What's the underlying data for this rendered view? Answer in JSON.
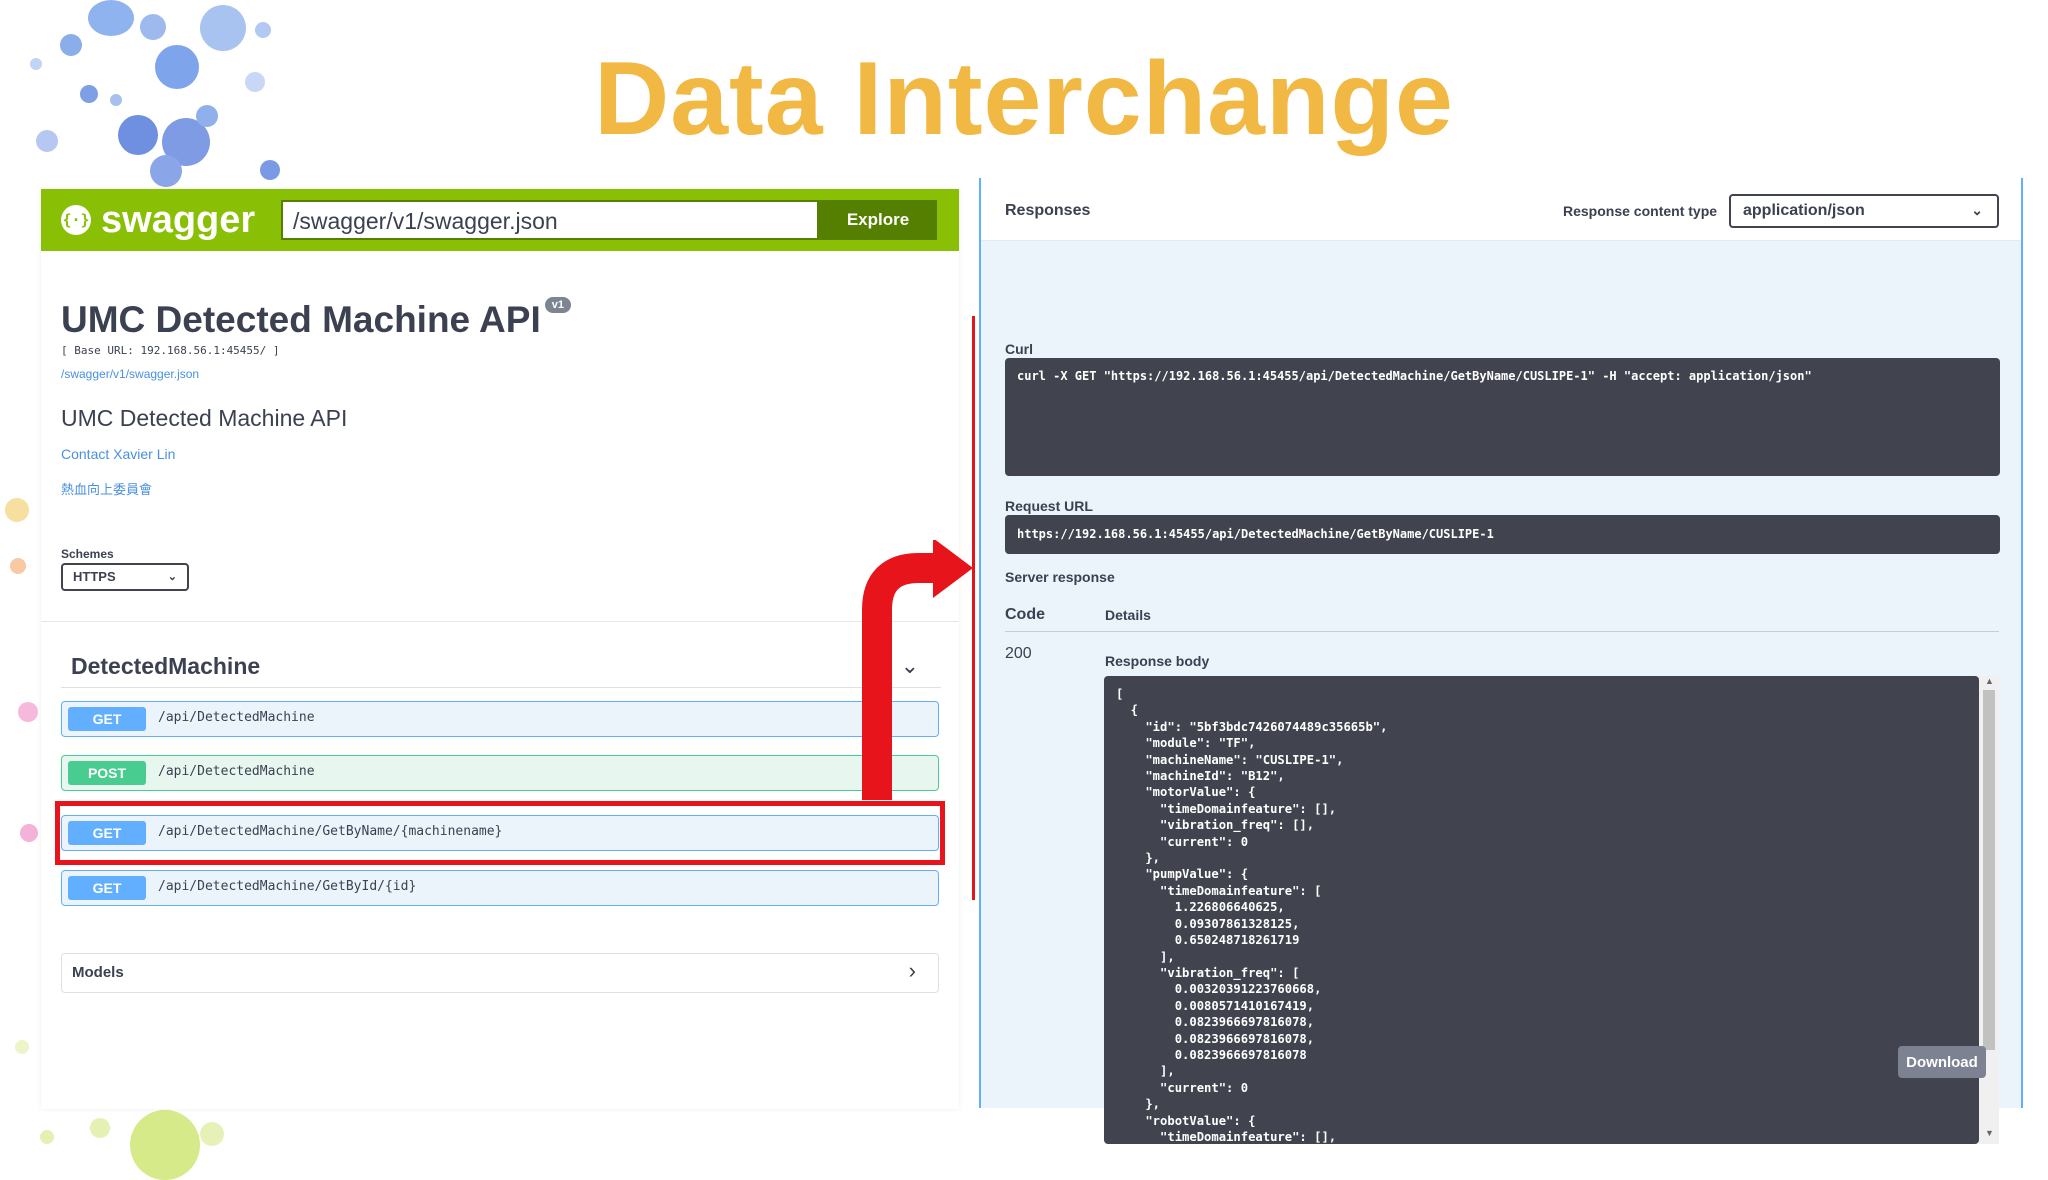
{
  "slide": {
    "title": "Data Interchange"
  },
  "swagger": {
    "logo_text": "swagger",
    "logo_icon": "swagger-braces-icon",
    "spec_url_value": "/swagger/v1/swagger.json",
    "explore_label": "Explore",
    "info": {
      "title": "UMC Detected Machine API",
      "version": "v1",
      "base_url": "[ Base URL: 192.168.56.1:45455/ ]",
      "spec_link": "/swagger/v1/swagger.json",
      "description": "UMC Detected Machine API",
      "contact": "Contact Xavier Lin",
      "license": "熱血向上委員會"
    },
    "schemes": {
      "label": "Schemes",
      "selected": "HTTPS"
    },
    "tag": {
      "name": "DetectedMachine"
    },
    "operations": [
      {
        "method": "GET",
        "path": "/api/DetectedMachine"
      },
      {
        "method": "POST",
        "path": "/api/DetectedMachine"
      },
      {
        "method": "GET",
        "path": "/api/DetectedMachine/GetByName/{machinename}"
      },
      {
        "method": "GET",
        "path": "/api/DetectedMachine/GetById/{id}"
      }
    ],
    "models_label": "Models",
    "colors": {
      "topbar": "#89bf04",
      "get": "#61affe",
      "post": "#49cc90",
      "highlight": "#e8141b"
    }
  },
  "responses": {
    "title": "Responses",
    "content_type_label": "Response content type",
    "content_type_value": "application/json",
    "curl_label": "Curl",
    "curl_command": "curl -X GET \"https://192.168.56.1:45455/api/DetectedMachine/GetByName/CUSLIPE-1\" -H \"accept: application/json\"",
    "request_url_label": "Request URL",
    "request_url": "https://192.168.56.1:45455/api/DetectedMachine/GetByName/CUSLIPE-1",
    "server_response_label": "Server response",
    "code_header": "Code",
    "details_header": "Details",
    "status_code": "200",
    "response_body_label": "Response body",
    "response_body": "[\n  {\n    \"id\": \"5bf3bdc7426074489c35665b\",\n    \"module\": \"TF\",\n    \"machineName\": \"CUSLIPE-1\",\n    \"machineId\": \"B12\",\n    \"motorValue\": {\n      \"timeDomainfeature\": [],\n      \"vibration_freq\": [],\n      \"current\": 0\n    },\n    \"pumpValue\": {\n      \"timeDomainfeature\": [\n        1.226806640625,\n        0.09307861328125,\n        0.650248718261719\n      ],\n      \"vibration_freq\": [\n        0.00320391223760668,\n        0.0080571410167419,\n        0.0823966697816078,\n        0.0823966697816078,\n        0.0823966697816078\n      ],\n      \"current\": 0\n    },\n    \"robotValue\": {\n      \"timeDomainfeature\": [],",
    "download_label": "Download"
  }
}
